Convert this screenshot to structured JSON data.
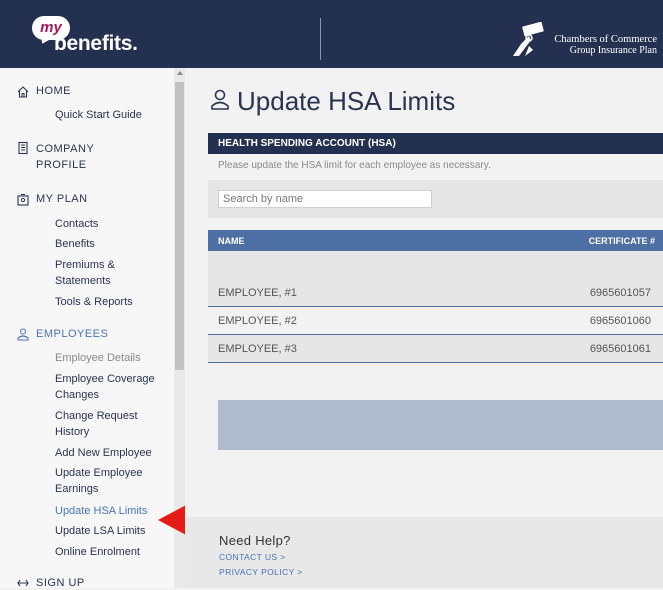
{
  "header": {
    "logo_my": "my",
    "logo_word": "benefits.",
    "org_line1": "Chambers of Commerce",
    "org_line2": "Group Insurance Plan"
  },
  "sidebar": {
    "home": {
      "label": "HOME",
      "items": [
        "Quick Start Guide"
      ]
    },
    "company": {
      "label_line1": "COMPANY",
      "label_line2": "PROFILE"
    },
    "plan": {
      "label": "MY PLAN",
      "items": [
        "Contacts",
        "Benefits",
        "Premiums &",
        "Statements",
        "Tools & Reports"
      ]
    },
    "employees": {
      "label": "EMPLOYEES",
      "employee_details": "Employee Details",
      "coverage_1": "Employee Coverage",
      "coverage_2": "Changes",
      "history_1": "Change Request",
      "history_2": "History",
      "add_new": "Add New Employee",
      "earnings_1": "Update Employee",
      "earnings_2": "Earnings",
      "hsa": "Update HSA Limits",
      "lsa": "Update LSA Limits",
      "online": "Online Enrolment"
    },
    "signup": {
      "label": "SIGN UP"
    }
  },
  "main": {
    "title": "Update HSA Limits",
    "panel_title": "HEALTH SPENDING ACCOUNT (HSA)",
    "panel_subtitle": "Please update the HSA limit for each employee as necessary.",
    "search_placeholder": "Search by name",
    "columns": {
      "name": "NAME",
      "certificate": "CERTIFICATE #"
    },
    "rows": [
      {
        "name": "EMPLOYEE, #1",
        "certificate": "6965601057"
      },
      {
        "name": "EMPLOYEE, #2",
        "certificate": "6965601060"
      },
      {
        "name": "EMPLOYEE, #3",
        "certificate": "6965601061"
      }
    ]
  },
  "help": {
    "title": "Need Help?",
    "contact": "CONTACT US >",
    "privacy": "PRIVACY POLICY >"
  },
  "colors": {
    "navy": "#23304f",
    "table_header": "#4e6fa3",
    "link": "#4a73b8",
    "brand_magenta": "#a8185b",
    "arrow_red": "#e41b17"
  },
  "icons": [
    "home-icon",
    "building-icon",
    "id-card-icon",
    "person-icon",
    "signup-icon",
    "user-icon",
    "keys-emblem-icon",
    "red-arrow-icon"
  ]
}
